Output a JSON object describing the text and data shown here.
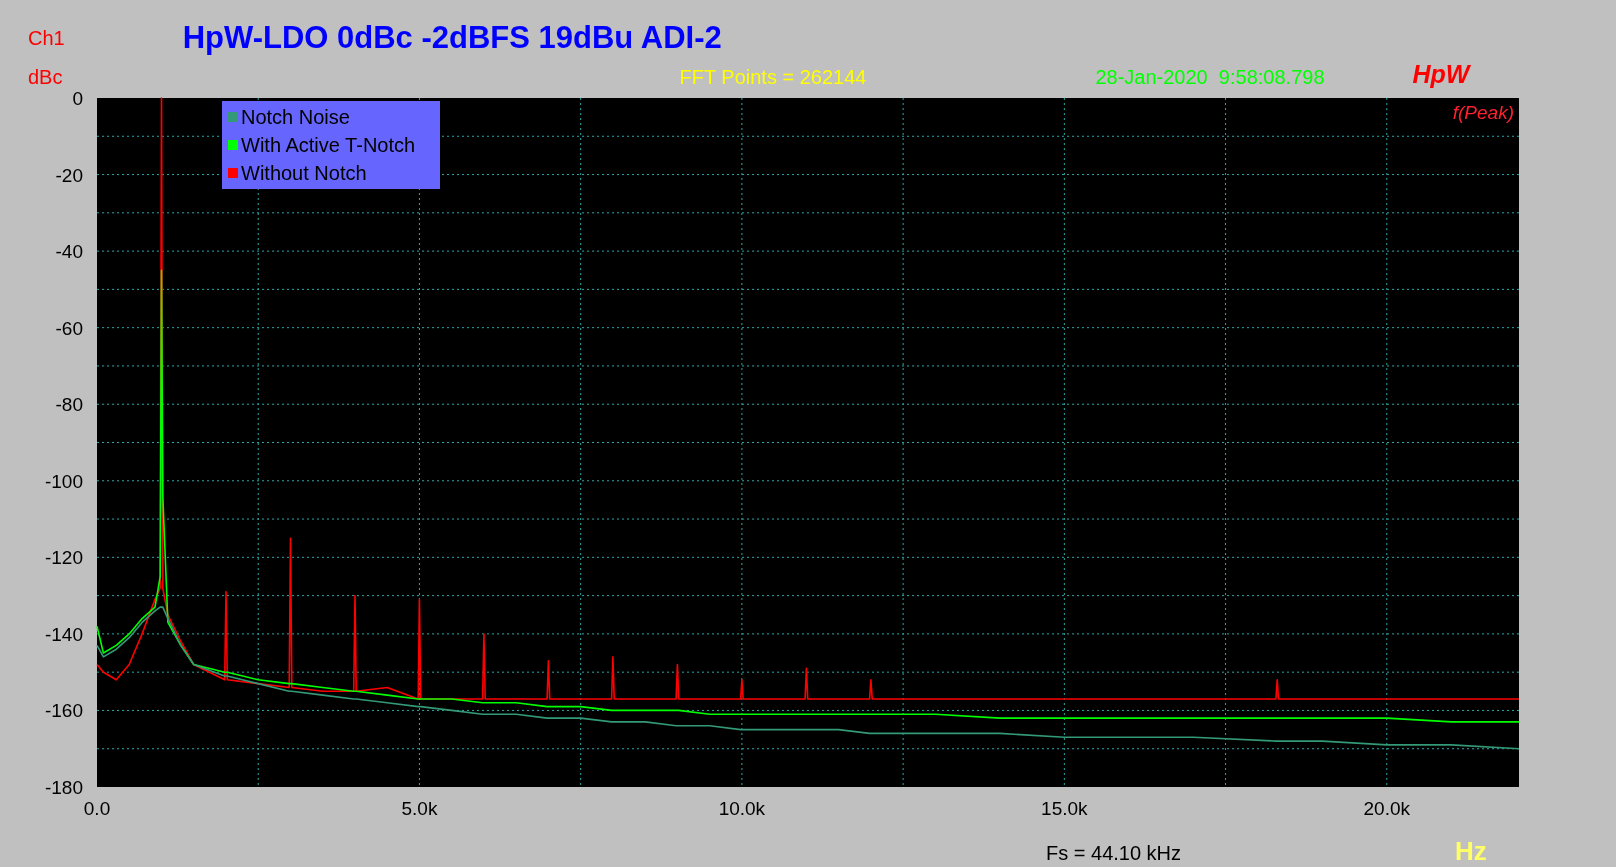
{
  "channel": {
    "name": "Ch1",
    "unit": "dBc"
  },
  "title": "HpW-LDO 0dBc -2dBFS 19dBu ADI-2",
  "fft_points": "FFT Points = 262144",
  "timestamp": "28-Jan-2020  9:58:08.798",
  "brand": "HpW",
  "marker_label": "f(Peak)",
  "chart_data": {
    "type": "line",
    "grid": true,
    "x": [
      0,
      100,
      300,
      500,
      700,
      900,
      980,
      1000,
      1020,
      1100,
      1300,
      1500,
      1980,
      2000,
      2020,
      2500,
      2980,
      3000,
      3020,
      3500,
      3980,
      4000,
      4020,
      4500,
      4980,
      5000,
      5020,
      5500,
      5980,
      6000,
      6020,
      6500,
      6980,
      7000,
      7020,
      7500,
      7980,
      8000,
      8020,
      8500,
      8980,
      9000,
      9020,
      9500,
      9980,
      10000,
      10020,
      10500,
      10980,
      11000,
      11020,
      11500,
      11980,
      12000,
      12020,
      13000,
      14000,
      15000,
      16000,
      17000,
      18280,
      18300,
      18320,
      19000,
      20000,
      21000,
      22050
    ],
    "series": [
      {
        "name": "Without Notch",
        "color": "#ff0000",
        "values": [
          -148,
          -150,
          -152,
          -148,
          -140,
          -131,
          -128,
          0,
          -128,
          -135,
          -142,
          -148,
          -152,
          -129,
          -152,
          -153,
          -154,
          -115,
          -154,
          -155,
          -155,
          -130,
          -155,
          -154,
          -157,
          -131,
          -157,
          -157,
          -157,
          -140,
          -157,
          -157,
          -157,
          -147,
          -157,
          -157,
          -157,
          -146,
          -157,
          -157,
          -157,
          -148,
          -157,
          -157,
          -157,
          -152,
          -157,
          -157,
          -157,
          -149,
          -157,
          -157,
          -157,
          -152,
          -157,
          -157,
          -157,
          -157,
          -157,
          -157,
          -157,
          -152,
          -157,
          -157,
          -157,
          -157,
          -157
        ]
      },
      {
        "name": "With Active T-Notch",
        "color": "#00ff00",
        "values": [
          -138,
          -145,
          -143,
          -140,
          -136,
          -133,
          -125,
          -45,
          -104,
          -137,
          -143,
          -148,
          -150,
          -150,
          -150,
          -152,
          -153,
          -153,
          -153,
          -154,
          -155,
          -155,
          -155,
          -156,
          -157,
          -157,
          -157,
          -157,
          -158,
          -158,
          -158,
          -158,
          -159,
          -159,
          -159,
          -159,
          -160,
          -160,
          -160,
          -160,
          -160,
          -160,
          -160,
          -161,
          -161,
          -161,
          -161,
          -161,
          -161,
          -161,
          -161,
          -161,
          -161,
          -161,
          -161,
          -161,
          -162,
          -162,
          -162,
          -162,
          -162,
          -162,
          -162,
          -162,
          -162,
          -163,
          -163
        ]
      },
      {
        "name": "Notch Noise",
        "color": "#339977",
        "values": [
          -143,
          -146,
          -144,
          -141,
          -137,
          -134,
          -133,
          -133,
          -133,
          -136,
          -143,
          -148,
          -151,
          -151,
          -151,
          -153,
          -155,
          -155,
          -155,
          -156,
          -157,
          -157,
          -157,
          -158,
          -159,
          -159,
          -159,
          -160,
          -161,
          -161,
          -161,
          -161,
          -162,
          -162,
          -162,
          -162,
          -163,
          -163,
          -163,
          -163,
          -164,
          -164,
          -164,
          -164,
          -165,
          -165,
          -165,
          -165,
          -165,
          -165,
          -165,
          -165,
          -166,
          -166,
          -166,
          -166,
          -166,
          -167,
          -167,
          -167,
          -168,
          -168,
          -168,
          -168,
          -169,
          -169,
          -170
        ]
      }
    ],
    "xlim": [
      0,
      22050
    ],
    "ylim": [
      -180,
      0
    ],
    "xticks": [
      {
        "value": 0,
        "label": "0.0"
      },
      {
        "value": 5000,
        "label": "5.0k"
      },
      {
        "value": 10000,
        "label": "10.0k"
      },
      {
        "value": 15000,
        "label": "15.0k"
      },
      {
        "value": 20000,
        "label": "20.0k"
      }
    ],
    "yticks": [
      0,
      -20,
      -40,
      -60,
      -80,
      -100,
      -120,
      -140,
      -160,
      -180
    ]
  },
  "sample_rate": "Fs = 44.10 kHz",
  "x_unit": "Hz"
}
